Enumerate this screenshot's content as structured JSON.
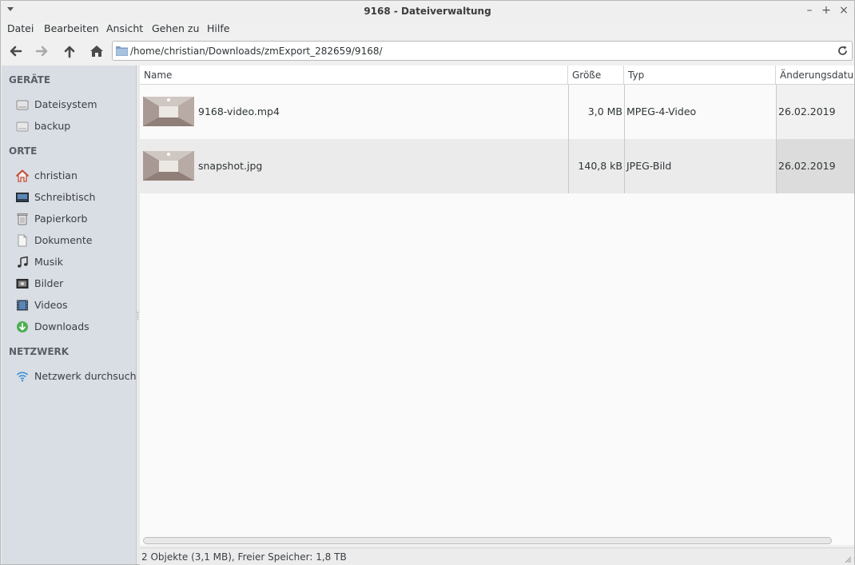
{
  "window": {
    "title": "9168 - Dateiverwaltung"
  },
  "menu": [
    "Datei",
    "Bearbeiten",
    "Ansicht",
    "Gehen zu",
    "Hilfe"
  ],
  "toolbar": {
    "path": "/home/christian/Downloads/zmExport_282659/9168/",
    "back_icon": "arrow-left-icon",
    "forward_icon": "arrow-right-icon",
    "up_icon": "arrow-up-icon",
    "home_icon": "home-icon",
    "reload_icon": "reload-icon"
  },
  "sidebar": {
    "devices_header": "GERÄTE",
    "devices": [
      {
        "label": "Dateisystem",
        "icon": "harddisk-icon"
      },
      {
        "label": "backup",
        "icon": "drive-icon"
      }
    ],
    "places_header": "ORTE",
    "places": [
      {
        "label": "christian",
        "icon": "home-icon"
      },
      {
        "label": "Schreibtisch",
        "icon": "desktop-icon"
      },
      {
        "label": "Papierkorb",
        "icon": "trash-icon"
      },
      {
        "label": "Dokumente",
        "icon": "document-icon"
      },
      {
        "label": "Musik",
        "icon": "music-icon"
      },
      {
        "label": "Bilder",
        "icon": "pictures-icon"
      },
      {
        "label": "Videos",
        "icon": "video-icon"
      },
      {
        "label": "Downloads",
        "icon": "download-icon"
      }
    ],
    "network_header": "NETZWERK",
    "network": [
      {
        "label": "Netzwerk durchsuch…",
        "icon": "wifi-icon"
      }
    ]
  },
  "list": {
    "columns": [
      "Name",
      "Größe",
      "Typ",
      "Änderungsdatum"
    ],
    "rows": [
      {
        "name": "9168-video.mp4",
        "size": "3,0 MB",
        "type": "MPEG-4-Video",
        "date": "26.02.2019"
      },
      {
        "name": "snapshot.jpg",
        "size": "140,8 kB",
        "type": "JPEG-Bild",
        "date": "26.02.2019"
      }
    ]
  },
  "status": {
    "text": "2 Objekte (3,1 MB), Freier Speicher: 1,8 TB"
  },
  "colors": {
    "sidebar_bg": "#d9dde4",
    "row_alt": "#ebebeb",
    "home_accent": "#c84b2f",
    "download_accent": "#4caf50",
    "wifi_accent": "#3b8fd8"
  }
}
